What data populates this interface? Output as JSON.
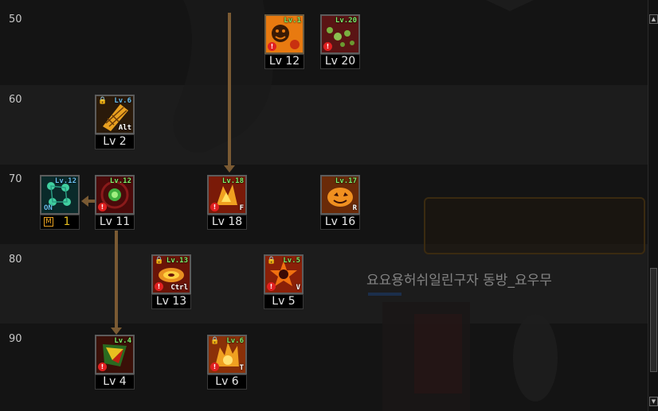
{
  "rows": [
    {
      "label": "50"
    },
    {
      "label": "60"
    },
    {
      "label": "70"
    },
    {
      "label": "80"
    },
    {
      "label": "90"
    }
  ],
  "skills": [
    {
      "name": "skill-sun-face",
      "lv_tag": "Lv.1",
      "level": "Lv 12",
      "hotkey": "",
      "icon": "sun-face-icon",
      "color": "#e87a10"
    },
    {
      "name": "skill-green-orbs",
      "lv_tag": "Lv.20",
      "level": "Lv 20",
      "hotkey": "",
      "icon": "green-orbs-icon",
      "color": "#6a1a1a"
    },
    {
      "name": "skill-net",
      "lv_tag": "Lv.6",
      "level": "Lv 2",
      "hotkey": "Alt",
      "icon": "net-icon",
      "color": "#6a4010"
    },
    {
      "name": "skill-toggle",
      "lv_tag": "Lv.12",
      "level": "",
      "hotkey": "ON",
      "icon": "toggle-icon",
      "color": "#0a3a3a",
      "counter": "1",
      "counter_badge": "M"
    },
    {
      "name": "skill-green-core",
      "lv_tag": "Lv.12",
      "level": "Lv 11",
      "hotkey": "",
      "icon": "green-core-icon",
      "color": "#5a1010"
    },
    {
      "name": "skill-fire-claw",
      "lv_tag": "Lv.18",
      "level": "Lv 18",
      "hotkey": "F",
      "icon": "fire-claw-icon",
      "color": "#8a2a08"
    },
    {
      "name": "skill-pumpkin",
      "lv_tag": "Lv.17",
      "level": "Lv 16",
      "hotkey": "R",
      "icon": "pumpkin-icon",
      "color": "#8a3a08"
    },
    {
      "name": "skill-spiral",
      "lv_tag": "Lv.13",
      "level": "Lv 13",
      "hotkey": "Ctrl",
      "icon": "spiral-icon",
      "color": "#7a1a08"
    },
    {
      "name": "skill-star-burst",
      "lv_tag": "Lv.5",
      "level": "Lv 5",
      "hotkey": "V",
      "icon": "star-burst-icon",
      "color": "#9a2a08"
    },
    {
      "name": "skill-crystal",
      "lv_tag": "Lv.4",
      "level": "Lv 4",
      "hotkey": "",
      "icon": "crystal-icon",
      "color": "#5a1a10"
    },
    {
      "name": "skill-flame-blast",
      "lv_tag": "Lv.6",
      "level": "Lv 6",
      "hotkey": "T",
      "icon": "flame-blast-icon",
      "color": "#a04008"
    }
  ],
  "overlay": {
    "character_name": "요요용허쉬일린구자 동방_요우무"
  },
  "colors": {
    "connector": "#7a5a33",
    "lv_tag": "#7ff06a",
    "warn": "#e02020"
  }
}
